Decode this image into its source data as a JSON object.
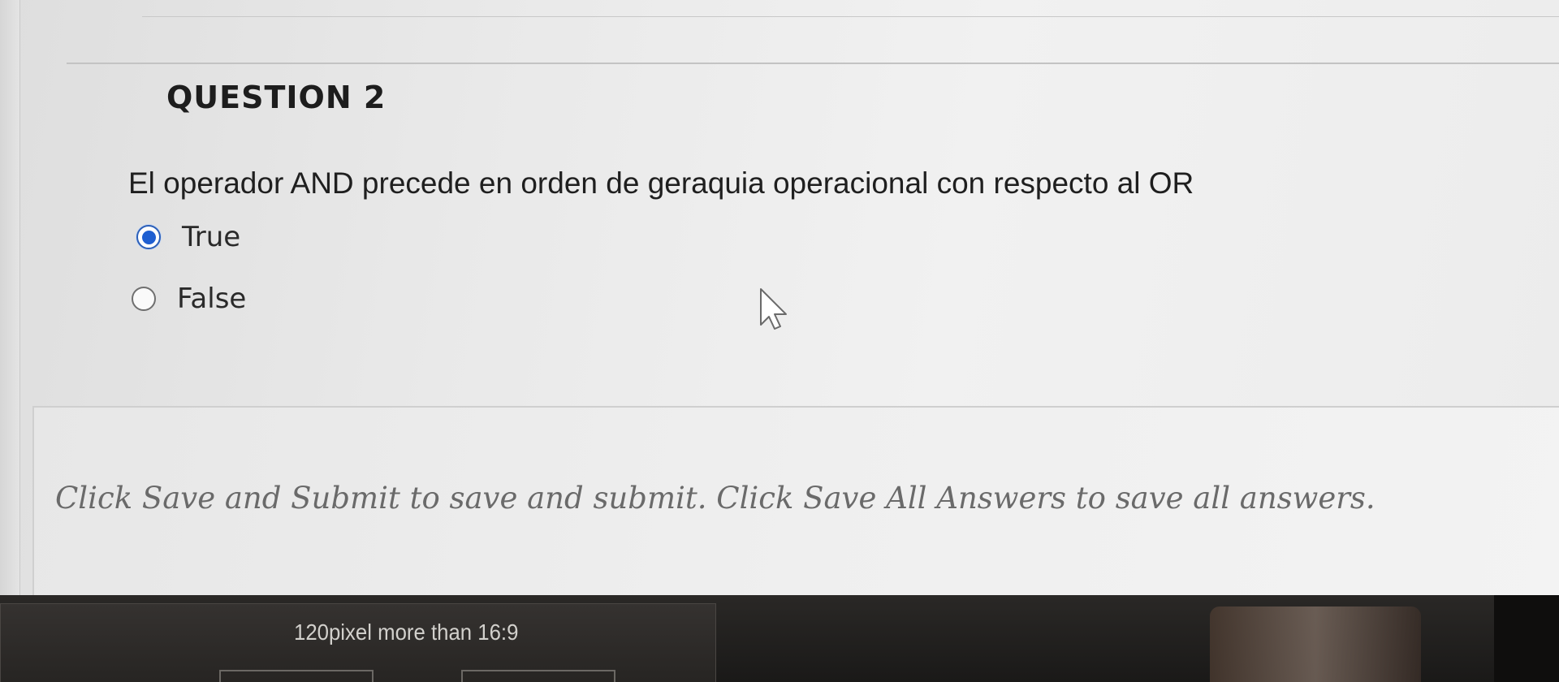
{
  "question": {
    "title": "QUESTION 2",
    "text": "El operador AND precede en orden de geraquia operacional con respecto al OR",
    "options": [
      {
        "label": "True",
        "selected": true
      },
      {
        "label": "False",
        "selected": false
      }
    ]
  },
  "footer": {
    "instruction": "Click Save and Submit to save and submit. Click Save All Answers to save all answers."
  },
  "bezel": {
    "label": "120pixel more than 16:9"
  },
  "colors": {
    "accent": "#1f5fd1",
    "title_text": "#1d1d1d",
    "instruction_text": "#6a6a6a"
  },
  "icons": {
    "radio_selected": "radio-selected-icon",
    "radio_unselected": "radio-unselected-icon",
    "cursor": "mouse-pointer-icon"
  }
}
